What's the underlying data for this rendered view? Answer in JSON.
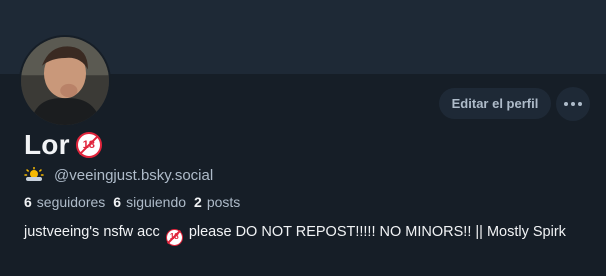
{
  "profile": {
    "display_name": "Lor",
    "name_badge": "18",
    "status_emoji": "sun-behind-cloud",
    "handle": "@veeingjust.bsky.social",
    "stats": [
      {
        "count": "6",
        "label": "seguidores"
      },
      {
        "count": "6",
        "label": "siguiendo"
      },
      {
        "count": "2",
        "label": "posts"
      }
    ],
    "bio": {
      "part1": "justveeing's nsfw acc",
      "badge": "18",
      "part2": "please DO NOT REPOST!!!!! NO MINORS!! || Mostly Spirk"
    }
  },
  "actions": {
    "edit_label": "Editar el perfil",
    "more_icon": "ellipsis-icon"
  },
  "colors": {
    "background": "#161e27",
    "banner": "#1e2936",
    "button_bg": "#1e2936",
    "muted_text": "#aebbc9",
    "text": "#f1f3f5",
    "badge_red": "#e0243b"
  }
}
